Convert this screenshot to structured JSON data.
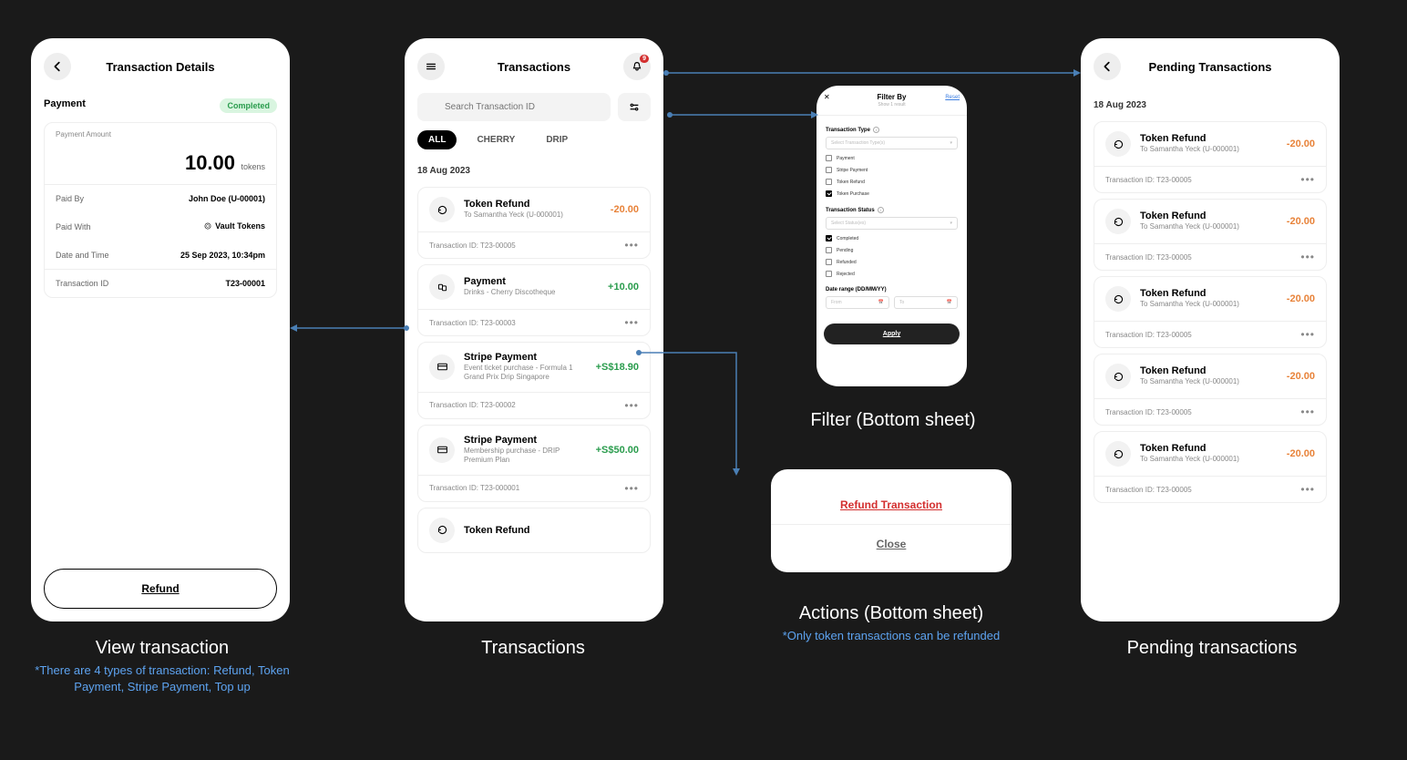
{
  "details": {
    "title": "Transaction Details",
    "section": "Payment",
    "status": "Completed",
    "amount_label": "Payment Amount",
    "amount": "10.00",
    "amount_unit": "tokens",
    "rows": [
      {
        "label": "Paid By",
        "value": "John Doe (U-00001)"
      },
      {
        "label": "Paid With",
        "value": "Vault Tokens"
      },
      {
        "label": "Date and Time",
        "value": "25 Sep 2023, 10:34pm"
      }
    ],
    "txid_label": "Transaction ID",
    "txid": "T23-00001",
    "refund_btn": "Refund"
  },
  "list": {
    "title": "Transactions",
    "notif_count": "9",
    "search_placeholder": "Search Transaction ID",
    "chips": [
      "ALL",
      "CHERRY",
      "DRIP"
    ],
    "date": "18 Aug 2023",
    "items": [
      {
        "icon": "refund",
        "title": "Token Refund",
        "sub": "To Samantha Yeck (U-000001)",
        "amt": "-20.00",
        "cls": "amt-neg",
        "id": "Transaction ID: T23-00005"
      },
      {
        "icon": "pay",
        "title": "Payment",
        "sub": "Drinks - Cherry Discotheque",
        "amt": "+10.00",
        "cls": "amt-pos",
        "id": "Transaction ID: T23-00003"
      },
      {
        "icon": "stripe",
        "title": "Stripe Payment",
        "sub": "Event ticket purchase - Formula 1 Grand Prix Drip Singapore",
        "amt": "+S$18.90",
        "cls": "amt-pos",
        "id": "Transaction ID: T23-00002"
      },
      {
        "icon": "stripe",
        "title": "Stripe Payment",
        "sub": "Membership purchase - DRIP Premium Plan",
        "amt": "+S$50.00",
        "cls": "amt-pos",
        "id": "Transaction ID: T23-000001"
      },
      {
        "icon": "refund",
        "title": "Token Refund",
        "sub": "",
        "amt": "",
        "cls": "",
        "id": ""
      }
    ]
  },
  "pending": {
    "title": "Pending Transactions",
    "date": "18 Aug 2023",
    "items": [
      {
        "title": "Token Refund",
        "sub": "To Samantha Yeck (U-000001)",
        "amt": "-20.00",
        "id": "Transaction ID: T23-00005"
      },
      {
        "title": "Token Refund",
        "sub": "To Samantha Yeck (U-000001)",
        "amt": "-20.00",
        "id": "Transaction ID: T23-00005"
      },
      {
        "title": "Token Refund",
        "sub": "To Samantha Yeck (U-000001)",
        "amt": "-20.00",
        "id": "Transaction ID: T23-00005"
      },
      {
        "title": "Token Refund",
        "sub": "To Samantha Yeck (U-000001)",
        "amt": "-20.00",
        "id": "Transaction ID: T23-00005"
      },
      {
        "title": "Token Refund",
        "sub": "To Samantha Yeck (U-000001)",
        "amt": "-20.00",
        "id": "Transaction ID: T23-00005"
      }
    ]
  },
  "filter": {
    "title": "Filter By",
    "subtitle": "Show 1 result",
    "reset": "Reset",
    "type_label": "Transaction Type",
    "type_placeholder": "Select Transaction Type(s)",
    "types": [
      {
        "label": "Payment",
        "checked": false
      },
      {
        "label": "Stripe Payment",
        "checked": false
      },
      {
        "label": "Token Refund",
        "checked": false
      },
      {
        "label": "Token Purchase",
        "checked": true
      }
    ],
    "status_label": "Transaction Status",
    "status_placeholder": "Select Status(es)",
    "statuses": [
      {
        "label": "Completed",
        "checked": true
      },
      {
        "label": "Pending",
        "checked": false
      },
      {
        "label": "Refunded",
        "checked": false
      },
      {
        "label": "Rejected",
        "checked": false
      }
    ],
    "date_label": "Date range (DD/MM/YY)",
    "from": "From",
    "to": "To",
    "apply": "Apply"
  },
  "actions": {
    "refund": "Refund Transaction",
    "close": "Close"
  },
  "captions": {
    "details": "View transaction",
    "details_sub": "*There are 4 types of transaction: Refund, Token Payment, Stripe Payment, Top up",
    "list": "Transactions",
    "filter": "Filter (Bottom sheet)",
    "actions": "Actions (Bottom sheet)",
    "actions_sub": "*Only token transactions can be refunded",
    "pending": "Pending transactions"
  }
}
